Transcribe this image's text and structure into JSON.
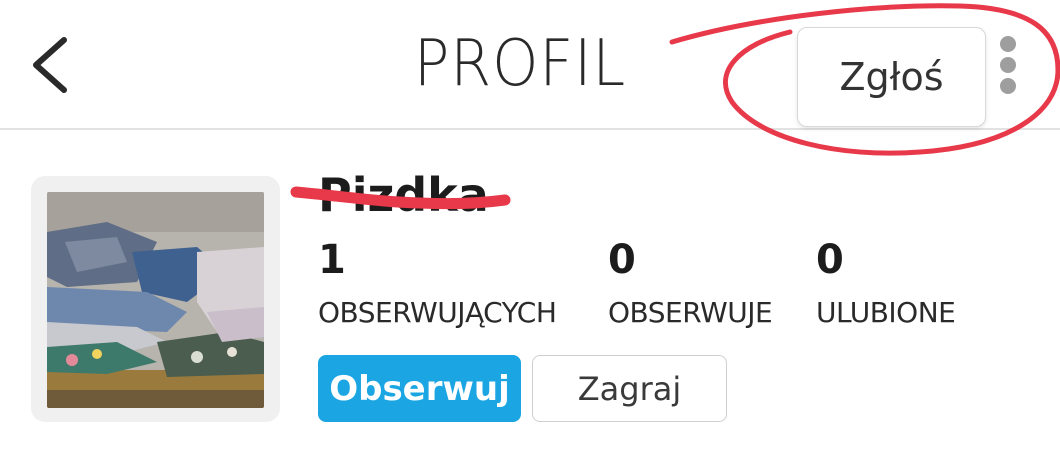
{
  "header": {
    "back_icon": "chevron-left-icon",
    "title": "PROFIL",
    "report_label": "Zgłoś",
    "more_icon": "vertical-dots-icon"
  },
  "profile": {
    "username": "Pizdka",
    "stats": [
      {
        "value": "1",
        "label": "OBSERWUJĄCYCH"
      },
      {
        "value": "0",
        "label": "OBSERWUJE"
      },
      {
        "value": "0",
        "label": "ULUBIONE"
      }
    ],
    "follow_label": "Obserwuj",
    "play_label": "Zagraj"
  },
  "colors": {
    "accent": "#1ba6e3",
    "annotation": "#e8394a",
    "divider": "#e2e2e2"
  }
}
